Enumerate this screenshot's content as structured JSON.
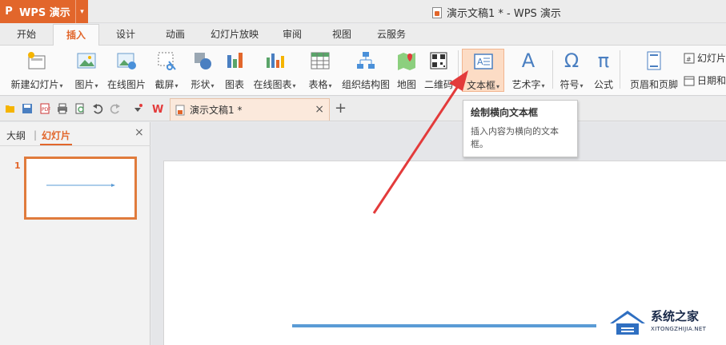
{
  "app": {
    "logo_letter": "P",
    "name": "WPS 演示",
    "dropdown": "▾"
  },
  "window": {
    "title": "演示文稿1 * - WPS 演示"
  },
  "tabs": [
    {
      "label": "开始"
    },
    {
      "label": "插入",
      "active": true
    },
    {
      "label": "设计"
    },
    {
      "label": "动画"
    },
    {
      "label": "幻灯片放映"
    },
    {
      "label": "审阅"
    },
    {
      "label": "视图"
    },
    {
      "label": "云服务"
    }
  ],
  "ribbon": {
    "new_slide": "新建幻灯片",
    "picture": "图片",
    "online_picture": "在线图片",
    "screenshot": "截屏",
    "shape": "形状",
    "chart": "图表",
    "online_chart": "在线图表",
    "table": "表格",
    "org_chart": "组织结构图",
    "map": "地图",
    "qrcode": "二维码",
    "textbox": "文本框",
    "wordart": "艺术字",
    "symbol": "符号",
    "formula": "公式",
    "header_footer": "页眉和页脚",
    "slide_number": "幻灯片",
    "datetime": "日期和",
    "caret": "▾",
    "symbol_glyph": "Ω",
    "formula_glyph": "π",
    "wordart_glyph": "A"
  },
  "doc_tabs": {
    "active": "演示文稿1 *",
    "close": "×",
    "add": "+"
  },
  "tooltip": {
    "title": "绘制横向文本框",
    "body_line1": "插入内容为横向的文本",
    "body_line2": "框。"
  },
  "left_panel": {
    "outline_tab": "大纲",
    "separator": "|",
    "slides_tab": "幻灯片",
    "close": "×",
    "slide_number": "1"
  },
  "watermark": {
    "title": "系统之家",
    "subtitle": "XITONGZHIJIA.NET"
  },
  "colors": {
    "accent": "#e2662b",
    "arrow": "#e33b3b",
    "connector": "#5a9bd5"
  }
}
